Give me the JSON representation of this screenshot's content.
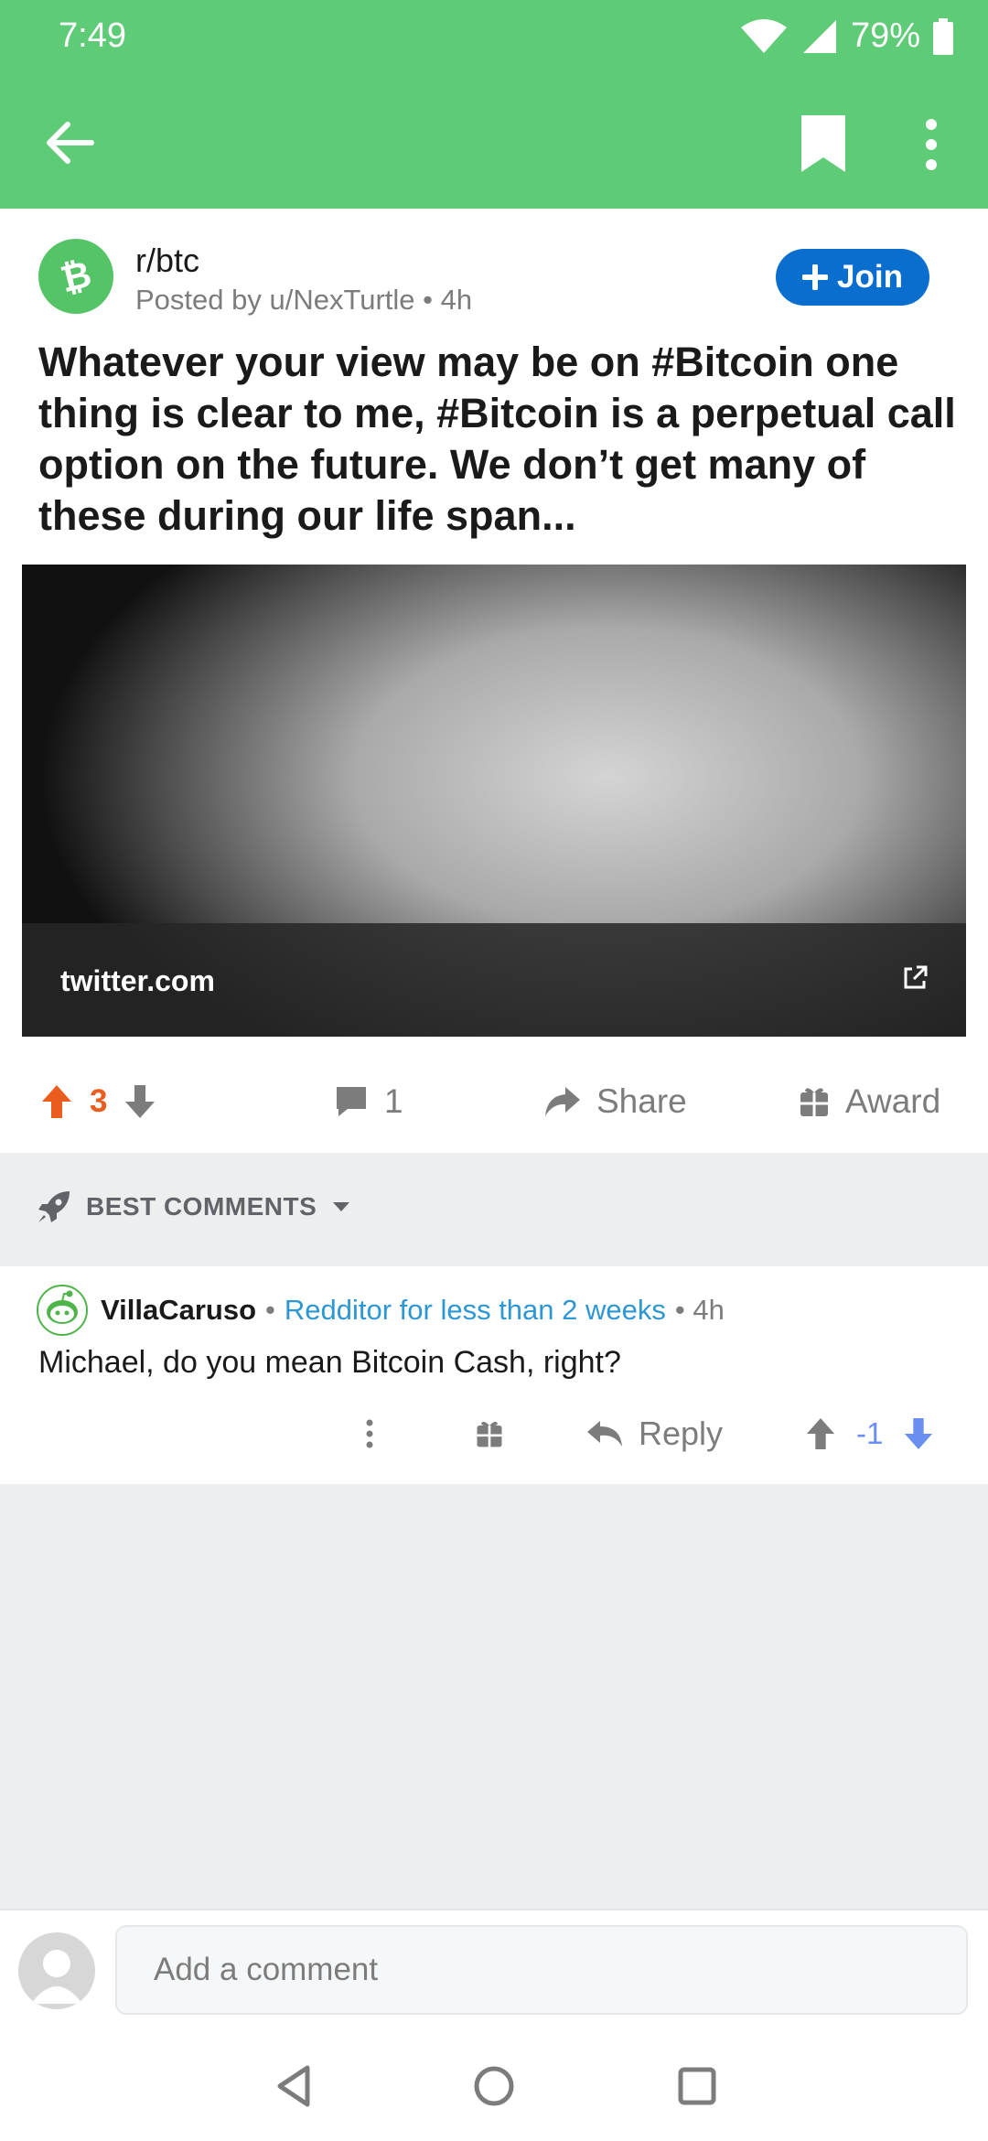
{
  "status_bar": {
    "time": "7:49",
    "battery": "79%"
  },
  "app_bar": {
    "back_icon": "arrow-left-icon",
    "bookmark_icon": "bookmark-icon",
    "more_icon": "more-vertical-icon"
  },
  "post": {
    "subreddit": "r/btc",
    "posted_by": "Posted by u/NexTurtle • 4h",
    "join_label": "Join",
    "title": "Whatever your view may be on #Bitcoin one thing is clear to me, #Bitcoin is a perpetual call option on the future. We don’t get many of these during our life span...",
    "link_domain": "twitter.com"
  },
  "actions": {
    "vote_count": "3",
    "comment_count": "1",
    "share_label": "Share",
    "award_label": "Award"
  },
  "sort": {
    "label": "BEST COMMENTS"
  },
  "comment": {
    "author": "VillaCaruso",
    "sep1": "•",
    "flair": "Redditor for less than 2 weeks",
    "time": "• 4h",
    "body": "Michael, do you mean Bitcoin Cash, right?",
    "reply_label": "Reply",
    "score": "-1"
  },
  "composer": {
    "placeholder": "Add a comment"
  },
  "colors": {
    "header_green": "#5ecb76",
    "join_blue": "#0a6ecf",
    "upvote_orange": "#ea5d1e",
    "downvote_blue": "#6a8ff0",
    "flair_blue": "#2d97d5"
  }
}
